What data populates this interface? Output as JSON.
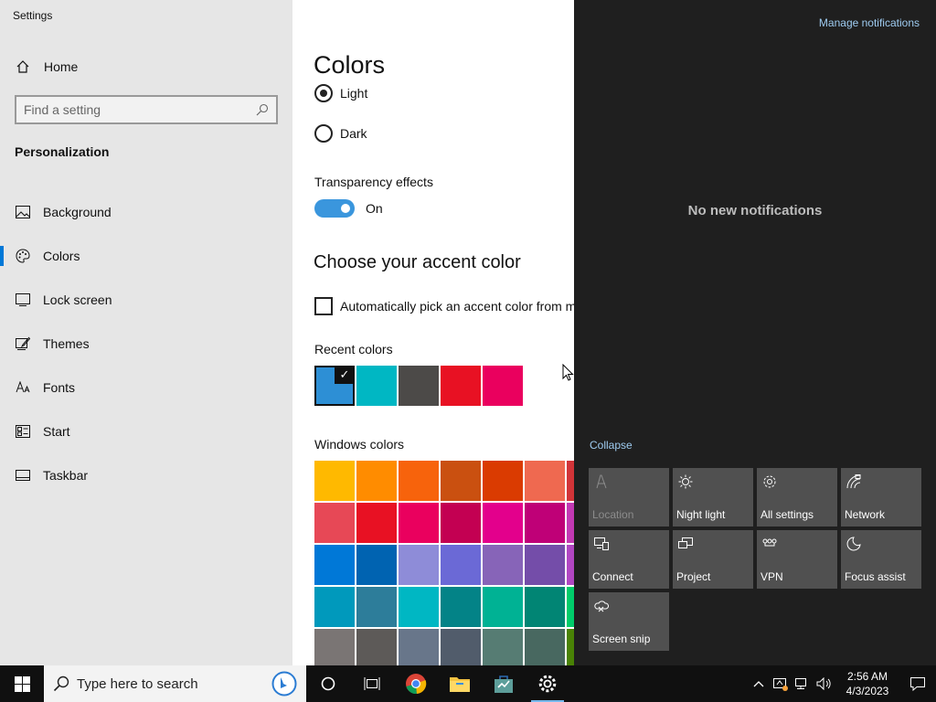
{
  "window": {
    "title": "Settings"
  },
  "sidebar": {
    "home_label": "Home",
    "search_placeholder": "Find a setting",
    "section_title": "Personalization",
    "items": [
      {
        "label": "Background",
        "icon": "image-icon"
      },
      {
        "label": "Colors",
        "icon": "palette-icon",
        "active": true
      },
      {
        "label": "Lock screen",
        "icon": "lock-screen-icon"
      },
      {
        "label": "Themes",
        "icon": "themes-icon"
      },
      {
        "label": "Fonts",
        "icon": "fonts-icon"
      },
      {
        "label": "Start",
        "icon": "start-icon"
      },
      {
        "label": "Taskbar",
        "icon": "taskbar-icon"
      }
    ]
  },
  "main": {
    "title": "Colors",
    "mode_options": [
      {
        "label": "Light",
        "selected": true
      },
      {
        "label": "Dark",
        "selected": false
      }
    ],
    "transparency_label": "Transparency effects",
    "transparency_state": "On",
    "accent_heading": "Choose your accent color",
    "auto_accent_label": "Automatically pick an accent color from my background",
    "recent_label": "Recent colors",
    "recent_colors": [
      "#2d8fd5",
      "#00b7c3",
      "#4c4a48",
      "#e81123",
      "#ea005e"
    ],
    "windows_label": "Windows colors",
    "windows_colors": [
      [
        "#ffb900",
        "#ff8c00",
        "#f7630c",
        "#ca5010",
        "#da3b01",
        "#ef6950",
        "#d13438"
      ],
      [
        "#e74856",
        "#e81123",
        "#ea005e",
        "#c30052",
        "#e3008c",
        "#bf0077",
        "#c239b3"
      ],
      [
        "#0078d7",
        "#0063b1",
        "#8e8cd8",
        "#6b69d6",
        "#8764b8",
        "#744da9",
        "#b146c2"
      ],
      [
        "#0099bc",
        "#2d7d9a",
        "#00b7c3",
        "#038387",
        "#00b294",
        "#018574",
        "#00cc6a"
      ],
      [
        "#7a7574",
        "#5d5a58",
        "#68768a",
        "#515c6b",
        "#567c73",
        "#486860",
        "#498205"
      ]
    ]
  },
  "action_center": {
    "manage_label": "Manage notifications",
    "empty_label": "No new notifications",
    "collapse_label": "Collapse",
    "tiles": [
      {
        "label": "Location",
        "icon": "location-icon",
        "enabled": false
      },
      {
        "label": "Night light",
        "icon": "night-light-icon",
        "enabled": true
      },
      {
        "label": "All settings",
        "icon": "gear-icon",
        "enabled": true
      },
      {
        "label": "Network",
        "icon": "network-icon",
        "enabled": true
      },
      {
        "label": "Connect",
        "icon": "connect-icon",
        "enabled": true
      },
      {
        "label": "Project",
        "icon": "project-icon",
        "enabled": true
      },
      {
        "label": "VPN",
        "icon": "vpn-icon",
        "enabled": true
      },
      {
        "label": "Focus assist",
        "icon": "moon-icon",
        "enabled": true
      },
      {
        "label": "Screen snip",
        "icon": "screen-snip-icon",
        "enabled": true
      }
    ]
  },
  "taskbar": {
    "search_placeholder": "Type here to search",
    "time": "2:56 AM",
    "date": "4/3/2023"
  }
}
